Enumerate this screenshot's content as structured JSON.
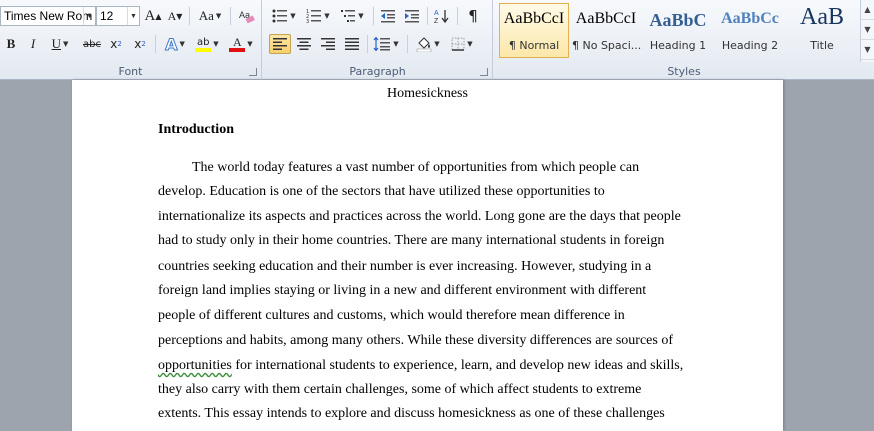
{
  "font_group": {
    "label": "Font",
    "font_name": "Times New Rom",
    "font_size": "12",
    "grow_label": "A",
    "shrink_label": "A",
    "change_case_label": "Aa",
    "bold_label": "B",
    "italic_label": "I",
    "underline_label": "U",
    "strike_label": "abc",
    "subscript_label": "x",
    "subscript_mark": "2",
    "superscript_label": "x",
    "superscript_mark": "2",
    "effects_label": "A",
    "highlight_label": "ab",
    "font_color_label": "A",
    "highlight_color": "#ffff00",
    "font_color": "#e01010"
  },
  "paragraph_group": {
    "label": "Paragraph",
    "pilcrow": "¶"
  },
  "styles_group": {
    "label": "Styles",
    "styles": [
      {
        "sample": "AaBbCcI",
        "name": "¶ Normal"
      },
      {
        "sample": "AaBbCcI",
        "name": "¶ No Spaci..."
      },
      {
        "sample": "AaBbC",
        "name": "Heading 1"
      },
      {
        "sample": "AaBbCc",
        "name": "Heading 2"
      },
      {
        "sample": "AaB",
        "name": "Title"
      }
    ],
    "heading_color": "#365f91"
  },
  "document": {
    "header": "Homesickness",
    "heading": "Introduction",
    "lines": [
      "The world today features a vast number of opportunities from which people can",
      "develop. Education is one of the sectors that have utilized these opportunities to",
      "internationalize its aspects and practices across the world. Long gone are the days that people",
      "had to study only in their home countries. There are many international students in foreign",
      "countries seeking education and their number is ever increasing. However, studying in a",
      "foreign land implies staying or living in a new and different environment with different",
      "people of different cultures and customs, which would therefore mean difference in",
      "perceptions and habits, among many others. While these diversity differences are sources of",
      "for international students to experience, learn, and develop new ideas and skills,",
      "they also carry with them certain challenges, some of which affect students to extreme",
      "extents. This essay intends to explore and discuss homesickness as one of these challenges"
    ],
    "misspelled_word": "opportunities"
  }
}
